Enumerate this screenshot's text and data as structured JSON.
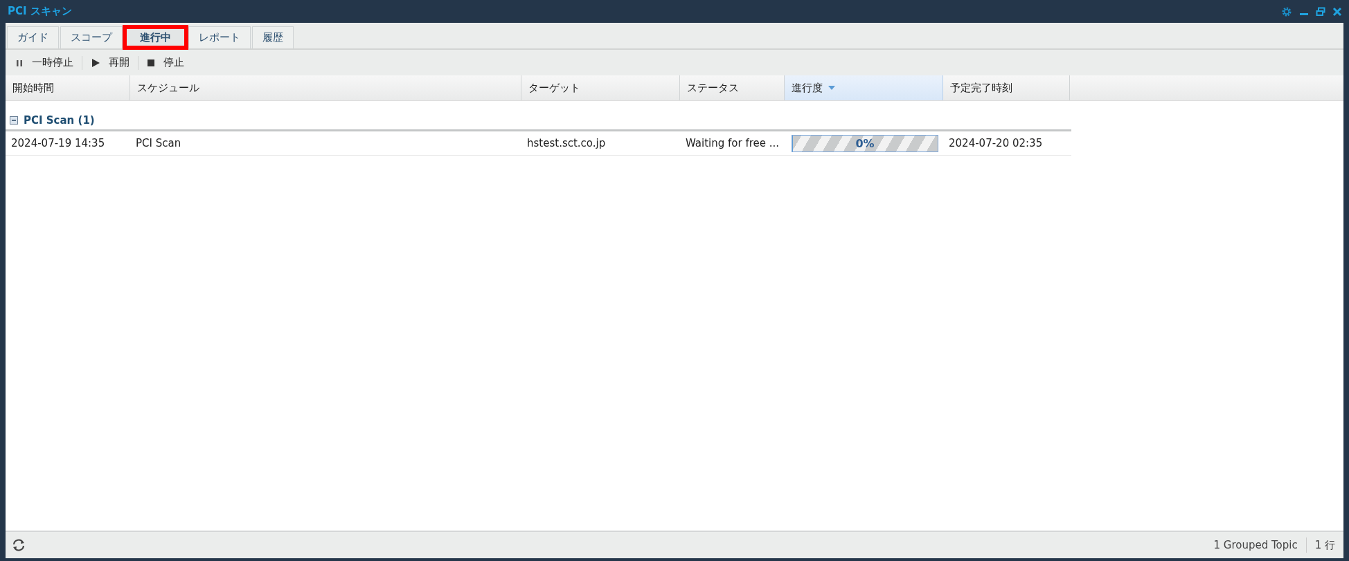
{
  "window": {
    "title": "PCI スキャン"
  },
  "tabs": [
    {
      "label": "ガイド",
      "selected": false
    },
    {
      "label": "スコープ",
      "selected": false
    },
    {
      "label": "進行中",
      "selected": true
    },
    {
      "label": "レポート",
      "selected": false
    },
    {
      "label": "履歴",
      "selected": false
    }
  ],
  "toolbar": [
    {
      "kind": "pause",
      "label": "一時停止"
    },
    {
      "kind": "play",
      "label": "再開"
    },
    {
      "kind": "stop",
      "label": "停止"
    }
  ],
  "table": {
    "columns": [
      {
        "label": "開始時間",
        "sorted": false
      },
      {
        "label": "スケジュール",
        "sorted": false
      },
      {
        "label": "ターゲット",
        "sorted": false
      },
      {
        "label": "ステータス",
        "sorted": false
      },
      {
        "label": "進行度",
        "sorted": true
      },
      {
        "label": "予定完了時刻",
        "sorted": false
      }
    ],
    "groups": [
      {
        "label": "PCI Scan (1)",
        "expanded": true,
        "rows": [
          {
            "start": "2024-07-19 14:35",
            "schedule": "PCI Scan",
            "target": "hstest.sct.co.jp",
            "status": "Waiting for free ...",
            "progress": {
              "level": 0,
              "reading": "0%"
            },
            "eta": "2024-07-20 02:35"
          }
        ]
      }
    ]
  },
  "status_bar": {
    "grouped": "1 Grouped Topic",
    "rows": "1 行"
  }
}
